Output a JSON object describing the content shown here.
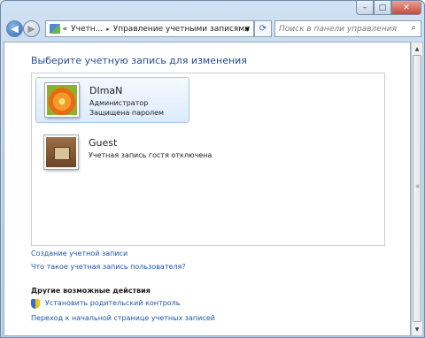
{
  "window": {
    "controls": {
      "minimize": "–",
      "maximize": "□",
      "close": "✕"
    }
  },
  "nav": {
    "back_icon": "◀",
    "forward_icon": "▶",
    "breadcrumb": [
      "«",
      "Учетн...",
      "▸",
      "Управление учетными записями"
    ],
    "dropdown_icon": "▼",
    "refresh_icon": "⟳",
    "search_placeholder": "Поиск в панели управления",
    "search_icon": "⌕"
  },
  "main": {
    "title": "Выберите учетную запись для изменения",
    "accounts": [
      {
        "name": "DImaN",
        "lines": [
          "Администратор",
          "Защищена паролем"
        ],
        "picture": "flower-icon",
        "selected": true
      },
      {
        "name": "Guest",
        "lines": [
          "Учетная запись гостя отключена"
        ],
        "picture": "guest-briefcase-icon",
        "selected": false
      }
    ],
    "links": [
      "Создание учетной записи",
      "Что такое учетная запись пользователя?"
    ],
    "other_heading": "Другие возможные действия",
    "other_links": [
      "Установить родительский контроль",
      "Переход к начальной странице учетных записей"
    ]
  },
  "scrollbar": {
    "up": "▲",
    "down": "▼",
    "grip": "≡"
  },
  "colors": {
    "accent": "#1f4f96",
    "link": "#1c56a8",
    "frame": "#b9cfe9"
  }
}
